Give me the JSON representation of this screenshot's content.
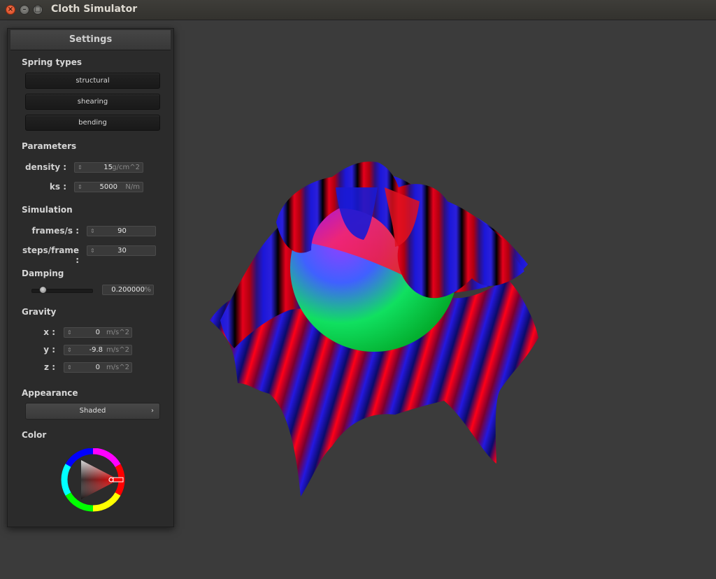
{
  "window": {
    "title": "Cloth Simulator",
    "close_glyph": "×",
    "min_glyph": "–",
    "max_glyph": "□"
  },
  "panel": {
    "title": "Settings",
    "spring_types": {
      "heading": "Spring types",
      "buttons": [
        "structural",
        "shearing",
        "bending"
      ]
    },
    "parameters": {
      "heading": "Parameters",
      "density": {
        "label": "density :",
        "value": "15",
        "unit": "g/cm^2"
      },
      "ks": {
        "label": "ks :",
        "value": "5000",
        "unit": "N/m"
      }
    },
    "simulation": {
      "heading": "Simulation",
      "fps": {
        "label": "frames/s :",
        "value": "90"
      },
      "steps": {
        "label": "steps/frame :",
        "value": "30"
      }
    },
    "damping": {
      "heading": "Damping",
      "value": "0.200000",
      "unit": "%",
      "slider_fraction": 0.2
    },
    "gravity": {
      "heading": "Gravity",
      "x": {
        "label": "x :",
        "value": "0",
        "unit": "m/s^2"
      },
      "y": {
        "label": "y :",
        "value": "-9.8",
        "unit": "m/s^2"
      },
      "z": {
        "label": "z :",
        "value": "0",
        "unit": "m/s^2"
      }
    },
    "appearance": {
      "heading": "Appearance",
      "selected": "Shaded",
      "chevron": "›"
    },
    "color": {
      "heading": "Color",
      "picked": "#ff0000"
    }
  },
  "icons": {
    "spinner": "spinner-icon",
    "chevron": "chevron-right-icon"
  }
}
